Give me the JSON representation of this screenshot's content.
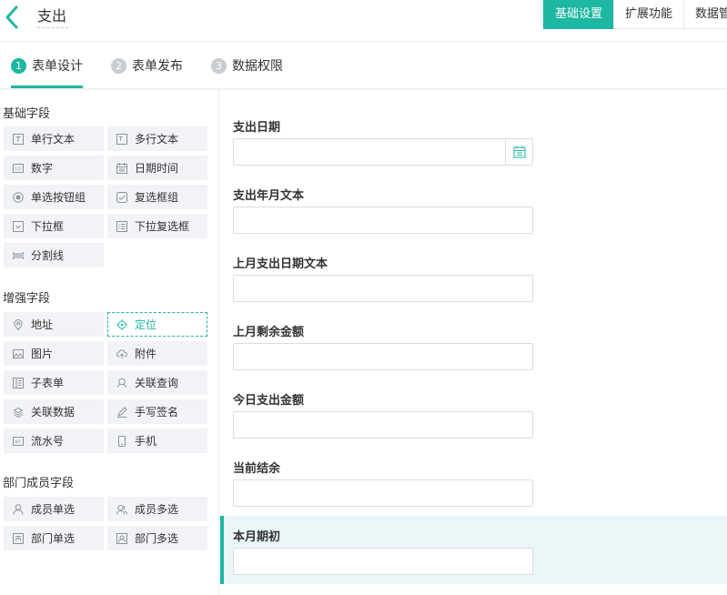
{
  "header": {
    "title": "支出",
    "tabs": [
      {
        "label": "基础设置",
        "active": true
      },
      {
        "label": "扩展功能",
        "active": false
      },
      {
        "label": "数据管",
        "active": false
      }
    ]
  },
  "steps": [
    {
      "num": "1",
      "label": "表单设计",
      "active": true
    },
    {
      "num": "2",
      "label": "表单发布",
      "active": false
    },
    {
      "num": "3",
      "label": "数据权限",
      "active": false
    }
  ],
  "palette": {
    "basic": {
      "title": "基础字段",
      "items": [
        "单行文本",
        "多行文本",
        "数字",
        "日期时间",
        "单选按钮组",
        "复选框组",
        "下拉框",
        "下拉复选框",
        "分割线"
      ]
    },
    "advanced": {
      "title": "增强字段",
      "items": [
        "地址",
        "定位",
        "图片",
        "附件",
        "子表单",
        "关联查询",
        "关联数据",
        "手写签名",
        "流水号",
        "手机"
      ]
    },
    "member": {
      "title": "部门成员字段",
      "items": [
        "成员单选",
        "成员多选",
        "部门单选",
        "部门多选"
      ]
    }
  },
  "form": {
    "fields": [
      {
        "label": "支出日期",
        "type": "date"
      },
      {
        "label": "支出年月文本",
        "type": "text"
      },
      {
        "label": "上月支出日期文本",
        "type": "text"
      },
      {
        "label": "上月剩余金额",
        "type": "number"
      },
      {
        "label": "今日支出金额",
        "type": "number"
      },
      {
        "label": "当前结余",
        "type": "number"
      },
      {
        "label": "本月期初",
        "type": "number"
      }
    ]
  },
  "colors": {
    "accent": "#1db7a2",
    "selected_bg": "#eaf6f8",
    "button_bg": "#f1f3f6"
  }
}
